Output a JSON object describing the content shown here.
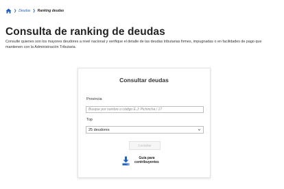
{
  "breadcrumb": {
    "home_icon": "home-icon",
    "items": [
      "Deudas",
      "Ranking deudas"
    ]
  },
  "page": {
    "title": "Consulta de ranking de deudas",
    "description": "Consulte quienes son los mayores deudores a nivel nacional y verifique el detalle de las deudas tributarias firmes, impugnadas o en facilidades de pago que mantienen con la Administración Tributaria."
  },
  "card": {
    "title": "Consultar deudas",
    "provincia_label": "Provincia",
    "provincia_placeholder": "Busque por nombre o código E.J: Pichincha / 17",
    "provincia_value": "",
    "top_label": "Top",
    "top_selected": "25 deudores",
    "submit_label": "Consultar",
    "guide_line1": "Guía para",
    "guide_line2": "contribuyentes",
    "guide_icon": "download-icon"
  },
  "colors": {
    "link": "#1f5fbf",
    "icon_blue": "#1f5fbf",
    "disabled_text": "#b5b5b5"
  }
}
